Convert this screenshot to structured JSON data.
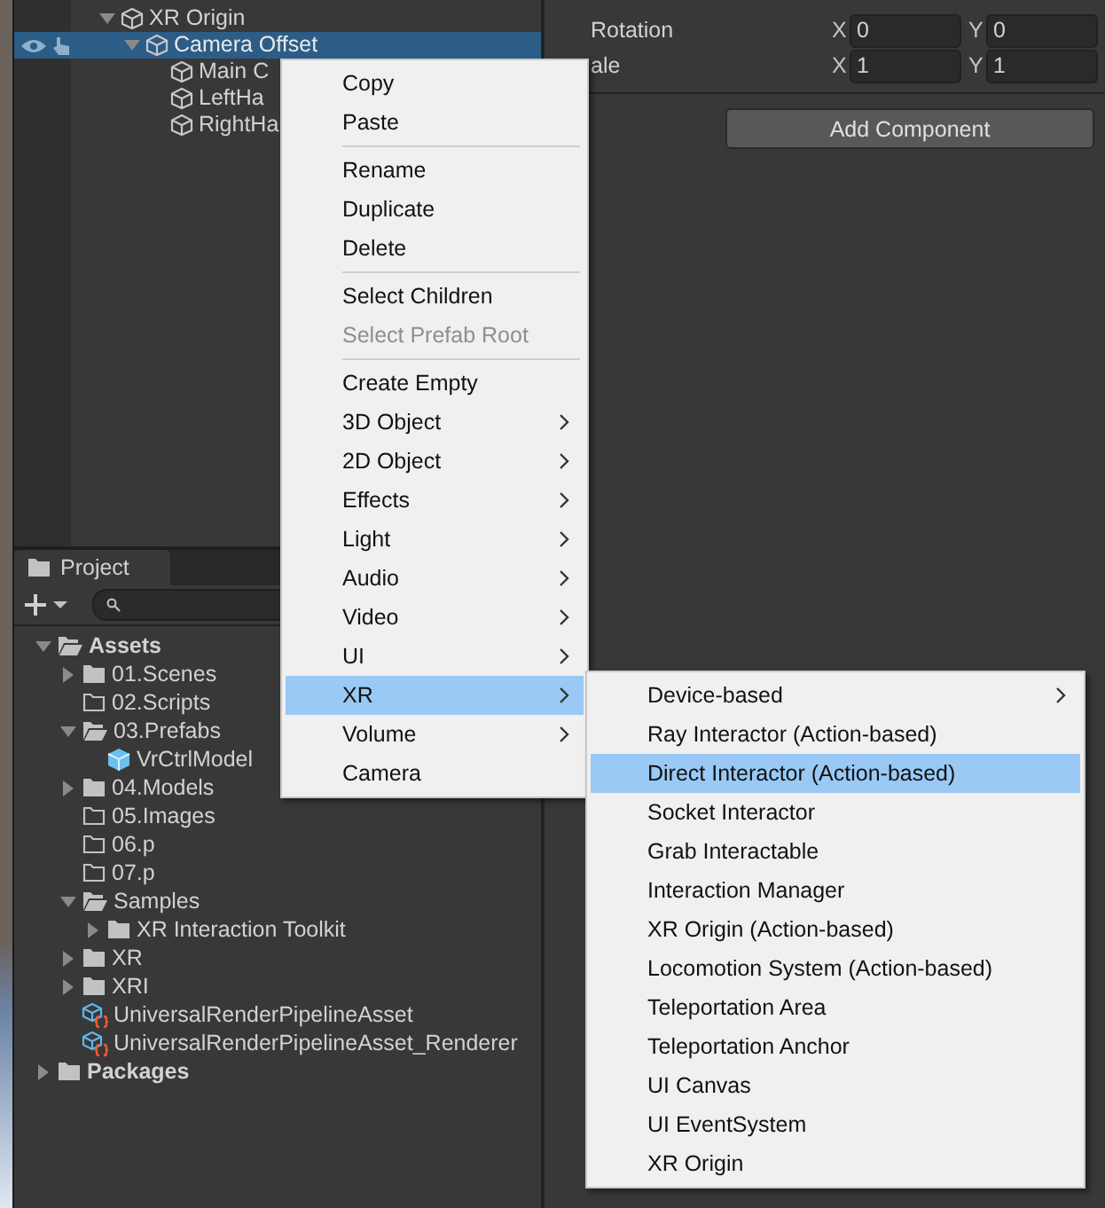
{
  "hierarchy": {
    "items": [
      {
        "label": "XR Origin",
        "expanded": true,
        "selected": false,
        "children": [
          {
            "label": "Camera Offset",
            "expanded": true,
            "selected": true,
            "children": [
              {
                "label": "Main C",
                "selected": false
              },
              {
                "label": "LeftHa",
                "selected": false
              },
              {
                "label": "RightHa",
                "selected": false
              }
            ]
          }
        ]
      }
    ]
  },
  "inspector": {
    "rows": [
      {
        "label": "Rotation",
        "fields": [
          {
            "axis": "X",
            "value": "0"
          },
          {
            "axis": "Y",
            "value": "0"
          }
        ]
      },
      {
        "label": "ale",
        "fields": [
          {
            "axis": "X",
            "value": "1"
          },
          {
            "axis": "Y",
            "value": "1"
          }
        ]
      }
    ],
    "add_component_button": "Add Component"
  },
  "project": {
    "tab": "Project",
    "tree": [
      {
        "label": "Assets",
        "kind": "folder",
        "expanded": true,
        "children": [
          {
            "label": "01.Scenes",
            "kind": "folder",
            "expanded": false
          },
          {
            "label": "02.Scripts",
            "kind": "empty_folder"
          },
          {
            "label": "03.Prefabs",
            "kind": "folder",
            "expanded": true,
            "children": [
              {
                "label": "VrCtrlModel",
                "kind": "prefab"
              }
            ]
          },
          {
            "label": "04.Models",
            "kind": "folder",
            "expanded": false
          },
          {
            "label": "05.Images",
            "kind": "empty_folder"
          },
          {
            "label": "06.p",
            "kind": "empty_folder"
          },
          {
            "label": "07.p",
            "kind": "empty_folder"
          },
          {
            "label": "Samples",
            "kind": "folder",
            "expanded": true,
            "children": [
              {
                "label": "XR Interaction Toolkit",
                "kind": "folder",
                "expanded": false
              }
            ]
          },
          {
            "label": "XR",
            "kind": "folder",
            "expanded": false
          },
          {
            "label": "XRI",
            "kind": "folder",
            "expanded": false
          },
          {
            "label": "UniversalRenderPipelineAsset",
            "kind": "asset"
          },
          {
            "label": "UniversalRenderPipelineAsset_Renderer",
            "kind": "asset"
          }
        ]
      },
      {
        "label": "Packages",
        "kind": "folder",
        "expanded": false
      }
    ]
  },
  "context_menu": {
    "groups": [
      {
        "items": [
          {
            "label": "Copy",
            "disabled": false,
            "submenu": false,
            "selected": false
          },
          {
            "label": "Paste",
            "disabled": false,
            "submenu": false,
            "selected": false
          }
        ]
      },
      {
        "items": [
          {
            "label": "Rename",
            "disabled": false,
            "submenu": false,
            "selected": false
          },
          {
            "label": "Duplicate",
            "disabled": false,
            "submenu": false,
            "selected": false
          },
          {
            "label": "Delete",
            "disabled": false,
            "submenu": false,
            "selected": false
          }
        ]
      },
      {
        "items": [
          {
            "label": "Select Children",
            "disabled": false,
            "submenu": false,
            "selected": false
          },
          {
            "label": "Select Prefab Root",
            "disabled": true,
            "submenu": false,
            "selected": false
          }
        ]
      },
      {
        "items": [
          {
            "label": "Create Empty",
            "disabled": false,
            "submenu": false,
            "selected": false
          },
          {
            "label": "3D Object",
            "disabled": false,
            "submenu": true,
            "selected": false
          },
          {
            "label": "2D Object",
            "disabled": false,
            "submenu": true,
            "selected": false
          },
          {
            "label": "Effects",
            "disabled": false,
            "submenu": true,
            "selected": false
          },
          {
            "label": "Light",
            "disabled": false,
            "submenu": true,
            "selected": false
          },
          {
            "label": "Audio",
            "disabled": false,
            "submenu": true,
            "selected": false
          },
          {
            "label": "Video",
            "disabled": false,
            "submenu": true,
            "selected": false
          },
          {
            "label": "UI",
            "disabled": false,
            "submenu": true,
            "selected": false
          },
          {
            "label": "XR",
            "disabled": false,
            "submenu": true,
            "selected": true
          },
          {
            "label": "Volume",
            "disabled": false,
            "submenu": true,
            "selected": false
          },
          {
            "label": "Camera",
            "disabled": false,
            "submenu": false,
            "selected": false
          }
        ]
      }
    ]
  },
  "submenu": {
    "items": [
      {
        "label": "Device-based",
        "submenu": true,
        "selected": false
      },
      {
        "label": "Ray Interactor (Action-based)",
        "submenu": false,
        "selected": false
      },
      {
        "label": "Direct Interactor (Action-based)",
        "submenu": false,
        "selected": true
      },
      {
        "label": "Socket Interactor",
        "submenu": false,
        "selected": false
      },
      {
        "label": "Grab Interactable",
        "submenu": false,
        "selected": false
      },
      {
        "label": "Interaction Manager",
        "submenu": false,
        "selected": false
      },
      {
        "label": "XR Origin (Action-based)",
        "submenu": false,
        "selected": false
      },
      {
        "label": "Locomotion System (Action-based)",
        "submenu": false,
        "selected": false
      },
      {
        "label": "Teleportation Area",
        "submenu": false,
        "selected": false
      },
      {
        "label": "Teleportation Anchor",
        "submenu": false,
        "selected": false
      },
      {
        "label": "UI Canvas",
        "submenu": false,
        "selected": false
      },
      {
        "label": "UI EventSystem",
        "submenu": false,
        "selected": false
      },
      {
        "label": "XR Origin",
        "submenu": false,
        "selected": false
      }
    ]
  }
}
